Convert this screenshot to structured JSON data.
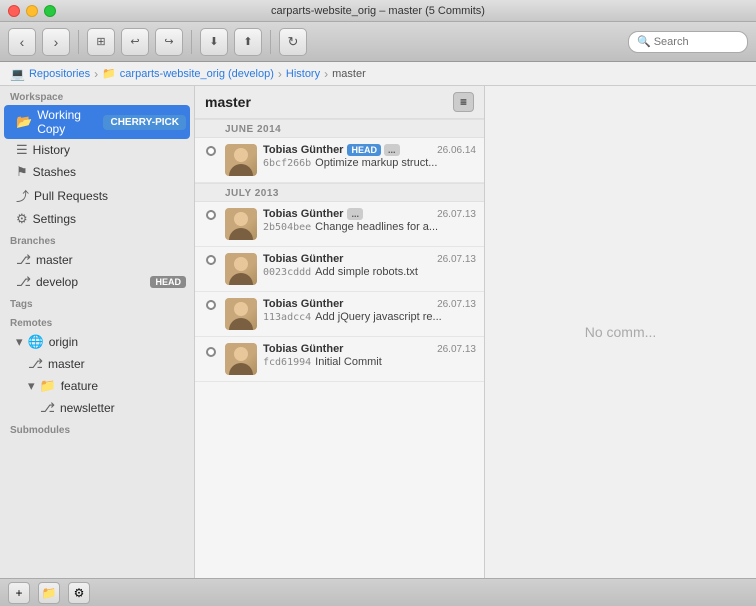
{
  "window": {
    "title": "carparts-website_orig – master (5 Commits)"
  },
  "toolbar": {
    "back_tooltip": "Back",
    "forward_tooltip": "Forward",
    "search_placeholder": "Search"
  },
  "breadcrumb": {
    "repositories": "Repositories",
    "repo": "carparts-website_orig (develop)",
    "history": "History",
    "branch": "master"
  },
  "sidebar": {
    "workspace_label": "Workspace",
    "working_copy_label": "Working Copy",
    "cherry_pick_badge": "CHERRY-PICK",
    "history_label": "History",
    "stashes_label": "Stashes",
    "pull_requests_label": "Pull Requests",
    "settings_label": "Settings",
    "branches_label": "Branches",
    "master_label": "master",
    "develop_label": "develop",
    "head_badge": "HEAD",
    "tags_label": "Tags",
    "remotes_label": "Remotes",
    "origin_label": "origin",
    "origin_master_label": "master",
    "origin_feature_label": "feature",
    "origin_newsletter_label": "newsletter",
    "submodules_label": "Submodules"
  },
  "commit_panel": {
    "branch_name": "master",
    "menu_icon": "≡",
    "june_2014_label": "JUNE 2014",
    "july_2013_label": "JULY 2013",
    "commits": [
      {
        "author": "Tobias Günther",
        "badges": [
          "HEAD",
          "..."
        ],
        "date": "26.06.14",
        "hash": "6bcf266b",
        "message": "Optimize markup struct...",
        "faded": false
      },
      {
        "author": "Tobias Günther",
        "badges": [
          "..."
        ],
        "date": "26.07.13",
        "hash": "2b504bee",
        "message": "Change headlines for a...",
        "faded": false
      },
      {
        "author": "Tobias Günther",
        "badges": [],
        "date": "26.07.13",
        "hash": "0023cddd",
        "message": "Add simple robots.txt",
        "faded": false
      },
      {
        "author": "Tobias Günther",
        "badges": [],
        "date": "26.07.13",
        "hash": "113adcc4",
        "message": "Add jQuery javascript re...",
        "faded": false
      },
      {
        "author": "Tobias Günther",
        "badges": [],
        "date": "26.07.13",
        "hash": "fcd61994",
        "message": "Initial Commit",
        "faded": false
      }
    ]
  },
  "right_panel": {
    "no_commit_text": "No comm..."
  },
  "bottom_bar": {
    "add_label": "+",
    "folder_label": "📁",
    "gear_label": "⚙"
  }
}
